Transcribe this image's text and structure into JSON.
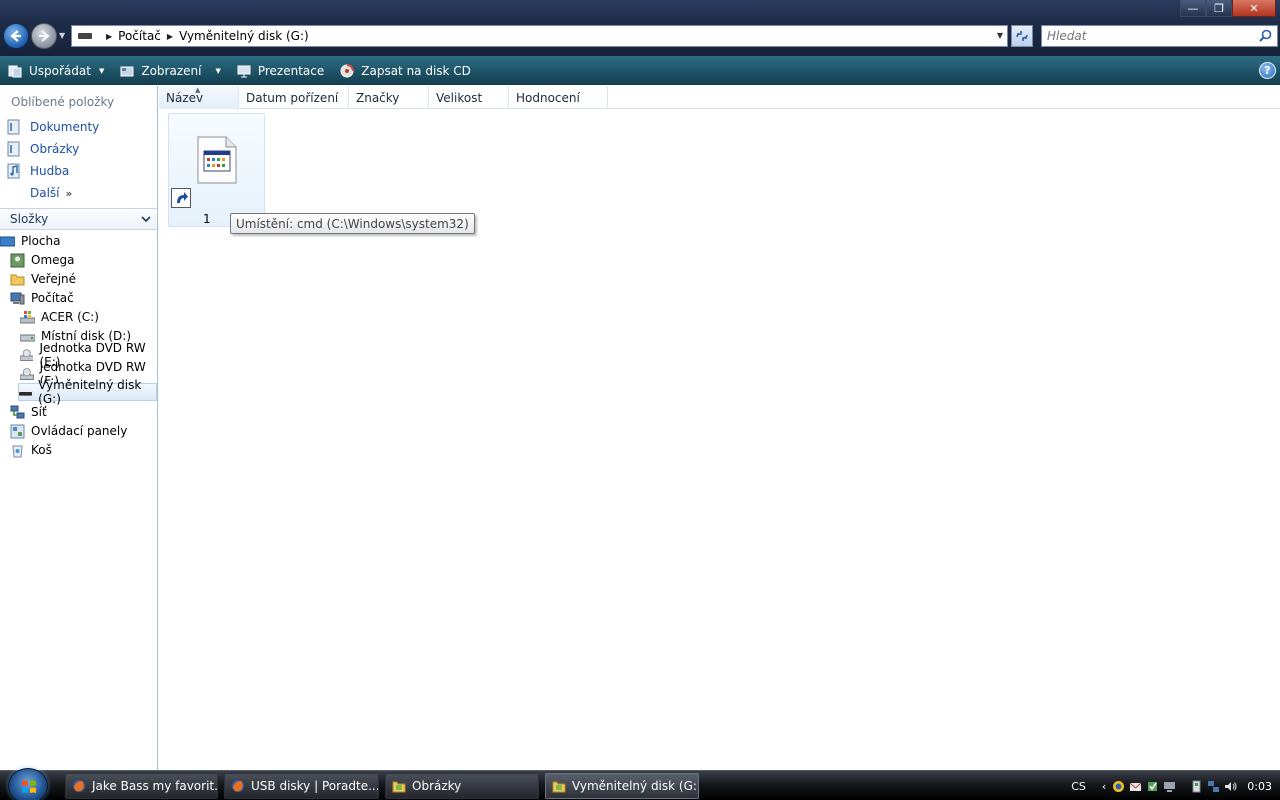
{
  "window": {
    "min_glyph": "—",
    "max_glyph": "❐",
    "close_glyph": "✕"
  },
  "address": {
    "segments": [
      "Počítač",
      "Vyměnitelný disk (G:)"
    ]
  },
  "search": {
    "placeholder": "Hledat"
  },
  "toolbar": {
    "organize": "Uspořádat",
    "views": "Zobrazení",
    "slideshow": "Prezentace",
    "burn": "Zapsat na disk CD",
    "help": "?"
  },
  "favorites": {
    "title": "Oblíbené položky",
    "items": [
      "Dokumenty",
      "Obrázky",
      "Hudba"
    ],
    "more": "Další",
    "more_chevron": "»"
  },
  "folders": {
    "header": "Složky",
    "tree": [
      "Plocha",
      "Omega",
      "Veřejné",
      "Počítač",
      "ACER (C:)",
      "Místní disk (D:)",
      "Jednotka DVD RW (E:)",
      "Jednotka DVD RW (F:)",
      "Vyměnitelný disk (G:)",
      "Síť",
      "Ovládací panely",
      "Koš"
    ]
  },
  "columns": [
    "Název",
    "Datum pořízení",
    "Značky",
    "Velikost",
    "Hodnocení"
  ],
  "file": {
    "name": "1",
    "tooltip": "Umístění: cmd (C:\\Windows\\system32)"
  },
  "taskbar": {
    "tasks": [
      "Jake Bass my favorit...",
      "USB disky | Poradte....",
      "Obrázky",
      "Vyměnitelný disk (G:)"
    ],
    "language": "CS",
    "tray_chevron": "‹",
    "clock": "0:03"
  },
  "colors": {
    "accent": "#1b4fa6",
    "cmdbar": "#1f5468",
    "titlebar": "#1e2c48"
  }
}
